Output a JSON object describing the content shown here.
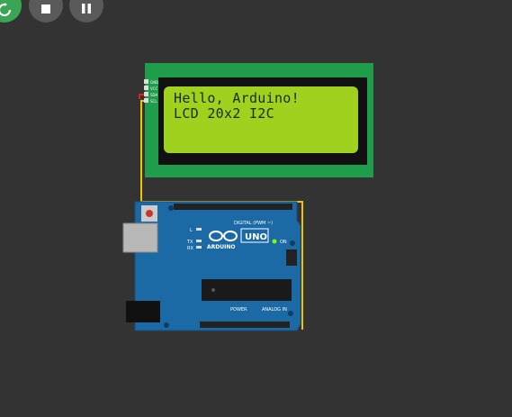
{
  "controls": {
    "restart": {
      "name": "restart-icon",
      "color": "#3aa655"
    },
    "stop": {
      "name": "stop-icon"
    },
    "pause": {
      "name": "pause-icon"
    }
  },
  "lcd": {
    "line1": "Hello, Arduino!",
    "line2": "LCD 20x2 I2C",
    "pins": [
      "GND",
      "VCC",
      "SDA",
      "SCL"
    ],
    "pcb_color": "#1f9d4b",
    "screen_color": "#9fd11e"
  },
  "arduino": {
    "brand": "ARDUINO",
    "model": "UNO",
    "digital_label": "DIGITAL (PWM ~)",
    "power_label": "POWER",
    "analog_label": "ANALOG IN",
    "on_label": "ON",
    "l_label": "L",
    "tx_label": "TX",
    "rx_label": "RX",
    "board_color": "#1b6aa5"
  },
  "wires": {
    "sda_color": "#f2c200",
    "scl_color": "#1aa34a",
    "gnd_color": "#e02020"
  }
}
